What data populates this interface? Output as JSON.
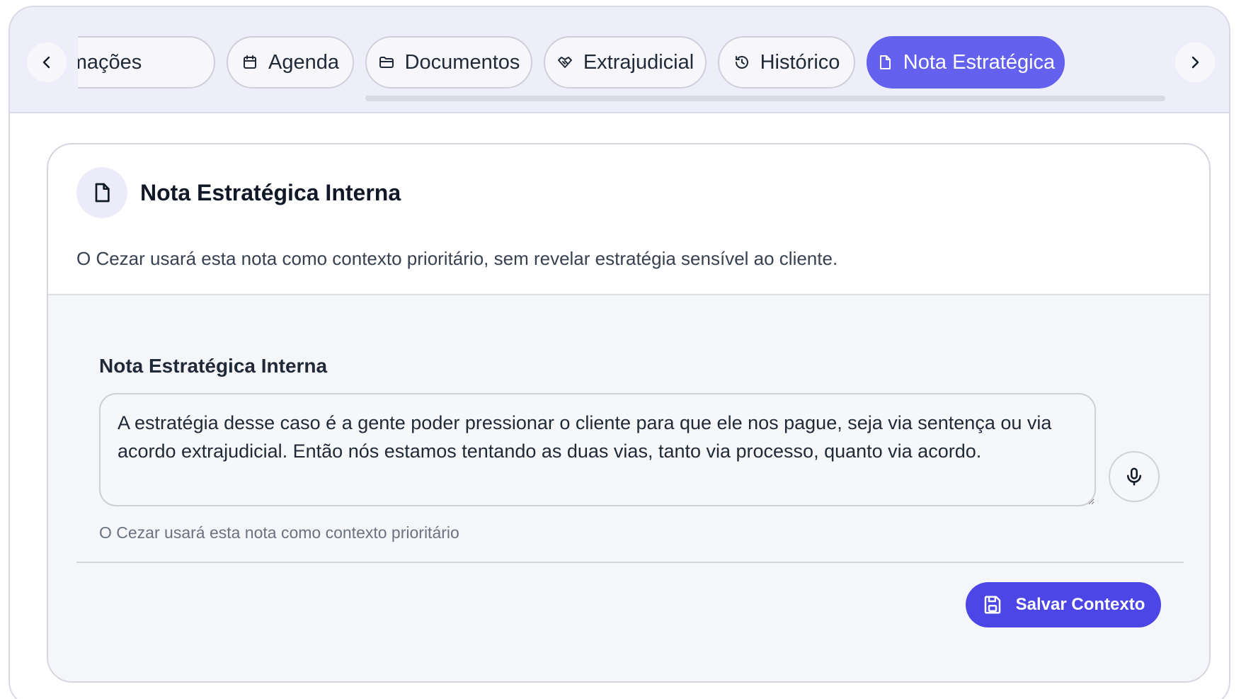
{
  "nav": {
    "scroll_left_icon": "chevron-left-icon",
    "scroll_right_icon": "chevron-right-icon",
    "tabs": [
      {
        "label": "Prazos/Intimações",
        "icon": "bell-icon"
      },
      {
        "label": "Agenda",
        "icon": "calendar-icon"
      },
      {
        "label": "Documentos",
        "icon": "folder-icon"
      },
      {
        "label": "Extrajudicial",
        "icon": "handshake-icon"
      },
      {
        "label": "Histórico",
        "icon": "history-icon"
      },
      {
        "label": "Nota Estratégica",
        "icon": "file-icon",
        "active": true
      }
    ],
    "colors": {
      "active_tab": "#6461ee",
      "tabbar_bg": "#eeeefb"
    }
  },
  "card": {
    "title": "Nota Estratégica Interna",
    "subtitle": "O Cezar usará esta nota como contexto prioritário, sem revelar estratégia sensível ao cliente.",
    "field_label": "Nota Estratégica Interna",
    "note_value": "A estratégia desse caso é a gente poder pressionar o cliente para que ele nos pague, seja via sentença ou via acordo extrajudicial. Então nós estamos tentando as duas vias, tanto via processo, quanto via acordo.",
    "helper_text": "O Cezar usará esta nota como contexto prioritário",
    "save_label": "Salvar Contexto",
    "colors": {
      "primary": "#4b46e5"
    }
  }
}
